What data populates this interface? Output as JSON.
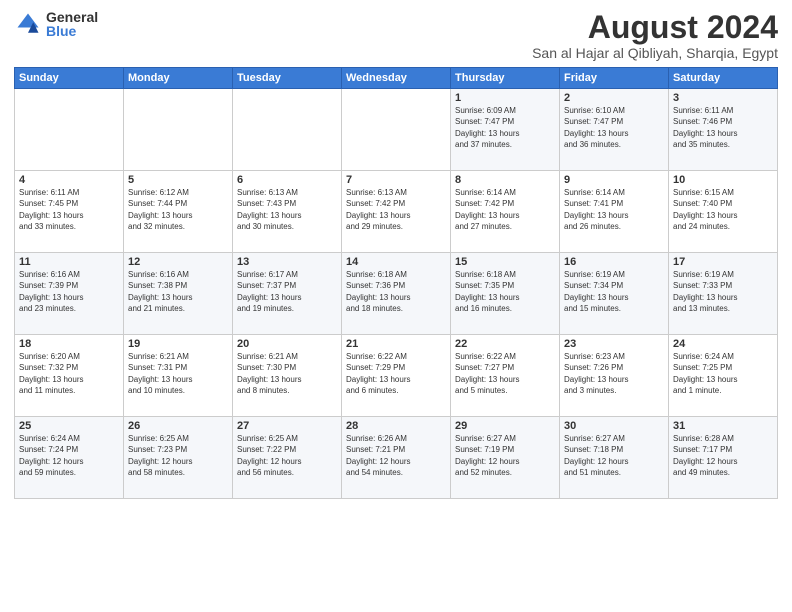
{
  "logo": {
    "general": "General",
    "blue": "Blue"
  },
  "title": "August 2024",
  "subtitle": "San al Hajar al Qibliyah, Sharqia, Egypt",
  "headers": [
    "Sunday",
    "Monday",
    "Tuesday",
    "Wednesday",
    "Thursday",
    "Friday",
    "Saturday"
  ],
  "weeks": [
    [
      {
        "day": "",
        "info": ""
      },
      {
        "day": "",
        "info": ""
      },
      {
        "day": "",
        "info": ""
      },
      {
        "day": "",
        "info": ""
      },
      {
        "day": "1",
        "info": "Sunrise: 6:09 AM\nSunset: 7:47 PM\nDaylight: 13 hours\nand 37 minutes."
      },
      {
        "day": "2",
        "info": "Sunrise: 6:10 AM\nSunset: 7:47 PM\nDaylight: 13 hours\nand 36 minutes."
      },
      {
        "day": "3",
        "info": "Sunrise: 6:11 AM\nSunset: 7:46 PM\nDaylight: 13 hours\nand 35 minutes."
      }
    ],
    [
      {
        "day": "4",
        "info": "Sunrise: 6:11 AM\nSunset: 7:45 PM\nDaylight: 13 hours\nand 33 minutes."
      },
      {
        "day": "5",
        "info": "Sunrise: 6:12 AM\nSunset: 7:44 PM\nDaylight: 13 hours\nand 32 minutes."
      },
      {
        "day": "6",
        "info": "Sunrise: 6:13 AM\nSunset: 7:43 PM\nDaylight: 13 hours\nand 30 minutes."
      },
      {
        "day": "7",
        "info": "Sunrise: 6:13 AM\nSunset: 7:42 PM\nDaylight: 13 hours\nand 29 minutes."
      },
      {
        "day": "8",
        "info": "Sunrise: 6:14 AM\nSunset: 7:42 PM\nDaylight: 13 hours\nand 27 minutes."
      },
      {
        "day": "9",
        "info": "Sunrise: 6:14 AM\nSunset: 7:41 PM\nDaylight: 13 hours\nand 26 minutes."
      },
      {
        "day": "10",
        "info": "Sunrise: 6:15 AM\nSunset: 7:40 PM\nDaylight: 13 hours\nand 24 minutes."
      }
    ],
    [
      {
        "day": "11",
        "info": "Sunrise: 6:16 AM\nSunset: 7:39 PM\nDaylight: 13 hours\nand 23 minutes."
      },
      {
        "day": "12",
        "info": "Sunrise: 6:16 AM\nSunset: 7:38 PM\nDaylight: 13 hours\nand 21 minutes."
      },
      {
        "day": "13",
        "info": "Sunrise: 6:17 AM\nSunset: 7:37 PM\nDaylight: 13 hours\nand 19 minutes."
      },
      {
        "day": "14",
        "info": "Sunrise: 6:18 AM\nSunset: 7:36 PM\nDaylight: 13 hours\nand 18 minutes."
      },
      {
        "day": "15",
        "info": "Sunrise: 6:18 AM\nSunset: 7:35 PM\nDaylight: 13 hours\nand 16 minutes."
      },
      {
        "day": "16",
        "info": "Sunrise: 6:19 AM\nSunset: 7:34 PM\nDaylight: 13 hours\nand 15 minutes."
      },
      {
        "day": "17",
        "info": "Sunrise: 6:19 AM\nSunset: 7:33 PM\nDaylight: 13 hours\nand 13 minutes."
      }
    ],
    [
      {
        "day": "18",
        "info": "Sunrise: 6:20 AM\nSunset: 7:32 PM\nDaylight: 13 hours\nand 11 minutes."
      },
      {
        "day": "19",
        "info": "Sunrise: 6:21 AM\nSunset: 7:31 PM\nDaylight: 13 hours\nand 10 minutes."
      },
      {
        "day": "20",
        "info": "Sunrise: 6:21 AM\nSunset: 7:30 PM\nDaylight: 13 hours\nand 8 minutes."
      },
      {
        "day": "21",
        "info": "Sunrise: 6:22 AM\nSunset: 7:29 PM\nDaylight: 13 hours\nand 6 minutes."
      },
      {
        "day": "22",
        "info": "Sunrise: 6:22 AM\nSunset: 7:27 PM\nDaylight: 13 hours\nand 5 minutes."
      },
      {
        "day": "23",
        "info": "Sunrise: 6:23 AM\nSunset: 7:26 PM\nDaylight: 13 hours\nand 3 minutes."
      },
      {
        "day": "24",
        "info": "Sunrise: 6:24 AM\nSunset: 7:25 PM\nDaylight: 13 hours\nand 1 minute."
      }
    ],
    [
      {
        "day": "25",
        "info": "Sunrise: 6:24 AM\nSunset: 7:24 PM\nDaylight: 12 hours\nand 59 minutes."
      },
      {
        "day": "26",
        "info": "Sunrise: 6:25 AM\nSunset: 7:23 PM\nDaylight: 12 hours\nand 58 minutes."
      },
      {
        "day": "27",
        "info": "Sunrise: 6:25 AM\nSunset: 7:22 PM\nDaylight: 12 hours\nand 56 minutes."
      },
      {
        "day": "28",
        "info": "Sunrise: 6:26 AM\nSunset: 7:21 PM\nDaylight: 12 hours\nand 54 minutes."
      },
      {
        "day": "29",
        "info": "Sunrise: 6:27 AM\nSunset: 7:19 PM\nDaylight: 12 hours\nand 52 minutes."
      },
      {
        "day": "30",
        "info": "Sunrise: 6:27 AM\nSunset: 7:18 PM\nDaylight: 12 hours\nand 51 minutes."
      },
      {
        "day": "31",
        "info": "Sunrise: 6:28 AM\nSunset: 7:17 PM\nDaylight: 12 hours\nand 49 minutes."
      }
    ]
  ]
}
